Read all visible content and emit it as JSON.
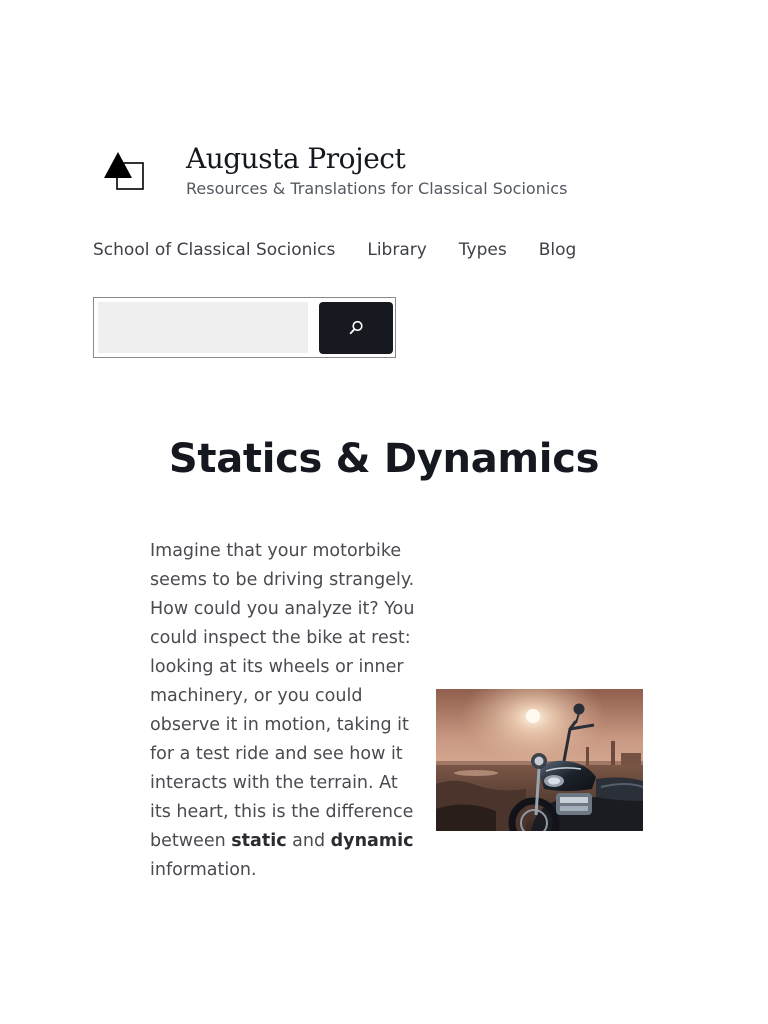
{
  "site": {
    "title": "Augusta Project",
    "tagline": "Resources & Translations for Classical Socionics"
  },
  "nav": {
    "items": [
      "School of Classical Socionics",
      "Library",
      "Types",
      "Blog"
    ]
  },
  "search": {
    "value": "",
    "placeholder": "",
    "button_icon": "search-icon"
  },
  "page": {
    "title": "Statics & Dynamics",
    "paragraph_before": "Imagine that your motorbike seems to be driving strangely. How could you analyze it? You could inspect the bike at rest: looking at its wheels or inner machinery, or you could observe it in motion, taking it for a test ride and see how it interacts with the terrain. At its heart, this is the difference between ",
    "bold_1": "static",
    "between": " and ",
    "bold_2": "dynamic",
    "paragraph_after": " information."
  },
  "colors": {
    "accent_dark": "#16191f",
    "search_field_bg": "#efefef"
  }
}
